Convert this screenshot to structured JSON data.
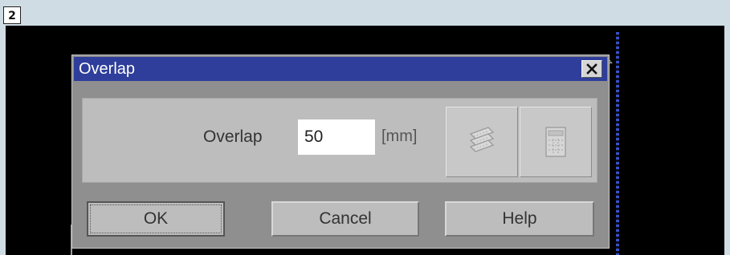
{
  "figure_number": "2",
  "dialog": {
    "title": "Overlap",
    "close_label": "×"
  },
  "form": {
    "overlap_label": "Overlap",
    "overlap_value": "50",
    "unit": "[mm]"
  },
  "icons": {
    "first": "stacked-plates-icon",
    "second": "panel-grid-icon"
  },
  "buttons": {
    "ok": "OK",
    "cancel": "Cancel",
    "help": "Help"
  },
  "colors": {
    "titlebar": "#2e3e9a",
    "dialog_bg": "#8f8f8f",
    "panel_bg": "#bdbdbd",
    "screen_bg": "#000000"
  }
}
